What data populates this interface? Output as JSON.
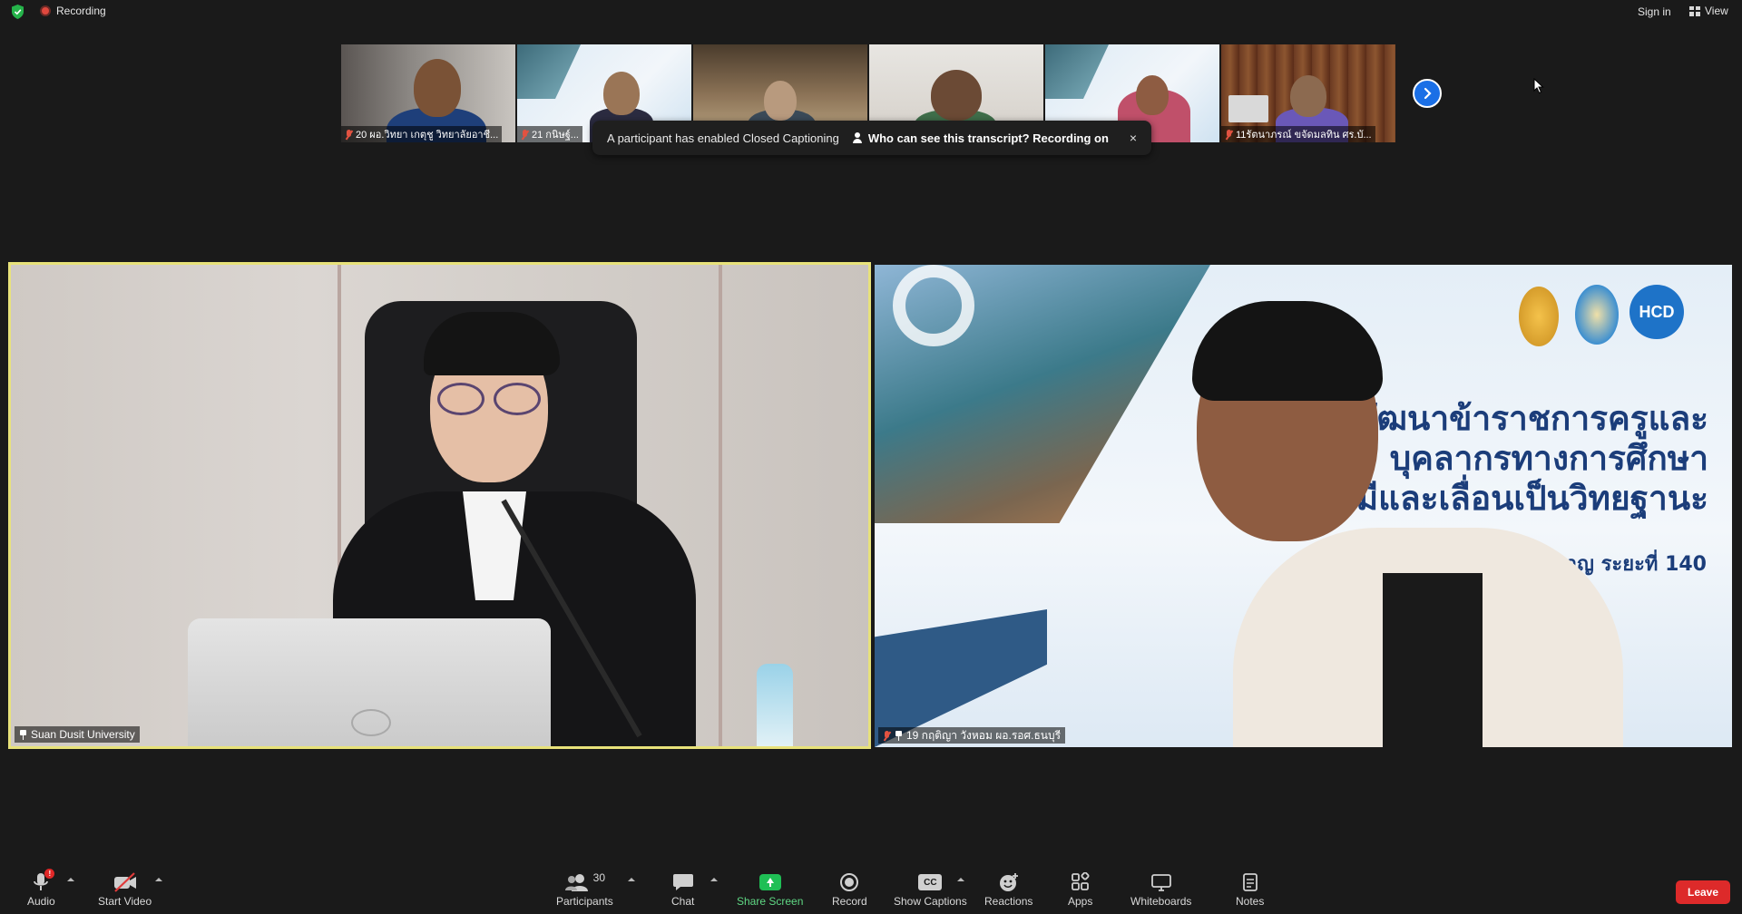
{
  "topbar": {
    "recording_label": "Recording",
    "signin_label": "Sign in",
    "view_label": "View"
  },
  "thumbnails": [
    {
      "name": "20 ผอ.วิทยา เกตุชู วิทยาลัยอาชี..."
    },
    {
      "name": "21 กนิษฐ์..."
    },
    {
      "name": ""
    },
    {
      "name": ""
    },
    {
      "name": ""
    },
    {
      "name": "11รัตนาภรณ์ ขจัดมลทิน ศร.บั..."
    }
  ],
  "toast": {
    "message": "A participant has enabled Closed Captioning",
    "link": "Who can see this transcript? Recording on",
    "close": "×"
  },
  "main_videos": {
    "left_name": "Suan Dusit University",
    "right_name": "19 กฤติญา วังหอม ผอ.รอศ.ธนบุรี",
    "slide_line1": "การพัฒนาข้าราชการครูและ",
    "slide_line2": "บุคลากรทางการศึกษา",
    "slide_line3": "ตั้งให้มีและเลื่อนเป็นวิทยฐานะ",
    "slide_sub": "ชวยการเชี่ยวชาญ ระยะที่ 140",
    "slide_logo": "HCD"
  },
  "toolbar": {
    "audio": "Audio",
    "audio_badge": "!",
    "video": "Start Video",
    "participants": "Participants",
    "participants_count": "30",
    "chat": "Chat",
    "share": "Share Screen",
    "record": "Record",
    "captions": "Show Captions",
    "captions_icon": "CC",
    "reactions": "Reactions",
    "apps": "Apps",
    "whiteboards": "Whiteboards",
    "notes": "Notes",
    "leave": "Leave"
  },
  "colors": {
    "accent_blue": "#1a6fe6",
    "share_green": "#1fbf55",
    "leave_red": "#dd2a2a",
    "active_speaker": "#e8e27a"
  }
}
